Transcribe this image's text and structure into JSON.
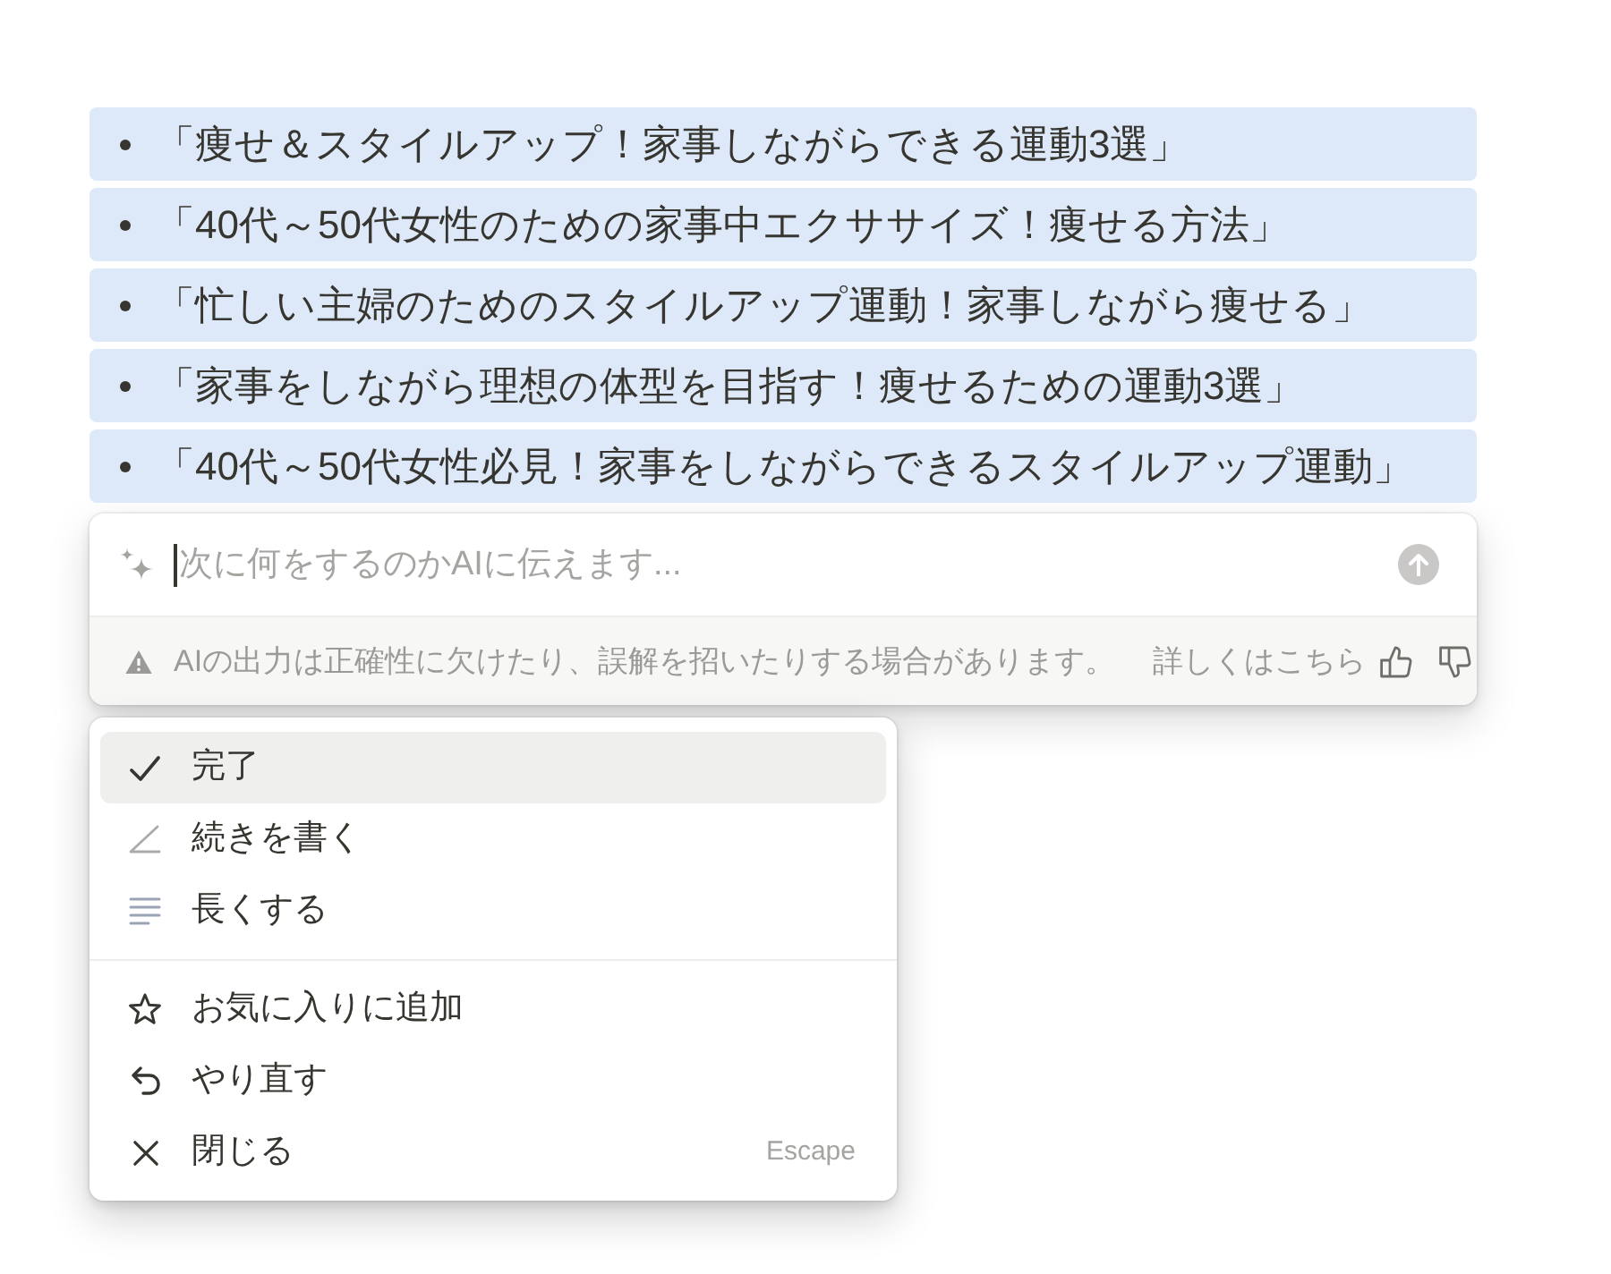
{
  "selection": {
    "items": [
      {
        "text": "「痩せ＆スタイルアップ！家事しながらできる運動3選」",
        "selected": true
      },
      {
        "text": "「40代～50代女性のための家事中エクササイズ！痩せる方法」",
        "selected": true
      },
      {
        "text": "「忙しい主婦のためのスタイルアップ運動！家事しながら痩せる」",
        "selected": true
      },
      {
        "text": "「家事をしながら理想の体型を目指す！痩せるための運動3選」",
        "selected": true
      },
      {
        "text": "「40代～50代女性必見！家事をしながらできるスタイルアップ運動」",
        "selected": true
      }
    ]
  },
  "ai_prompt": {
    "placeholder": "次に何をするのかAIに伝えます...",
    "disclaimer": "AIの出力は正確性に欠けたり、誤解を招いたりする場合があります。",
    "learn_more": "詳しくはこちら"
  },
  "menu": {
    "sections": [
      {
        "items": [
          {
            "kind": "done",
            "label": "完了",
            "selected": true
          },
          {
            "kind": "continue",
            "label": "続きを書く",
            "selected": false
          },
          {
            "kind": "lengthen",
            "label": "長くする",
            "selected": false
          }
        ]
      },
      {
        "items": [
          {
            "kind": "favorite",
            "label": "お気に入りに追加",
            "selected": false
          },
          {
            "kind": "retry",
            "label": "やり直す",
            "selected": false
          },
          {
            "kind": "close",
            "label": "閉じる",
            "selected": false,
            "shortcut": "Escape"
          }
        ]
      }
    ]
  }
}
